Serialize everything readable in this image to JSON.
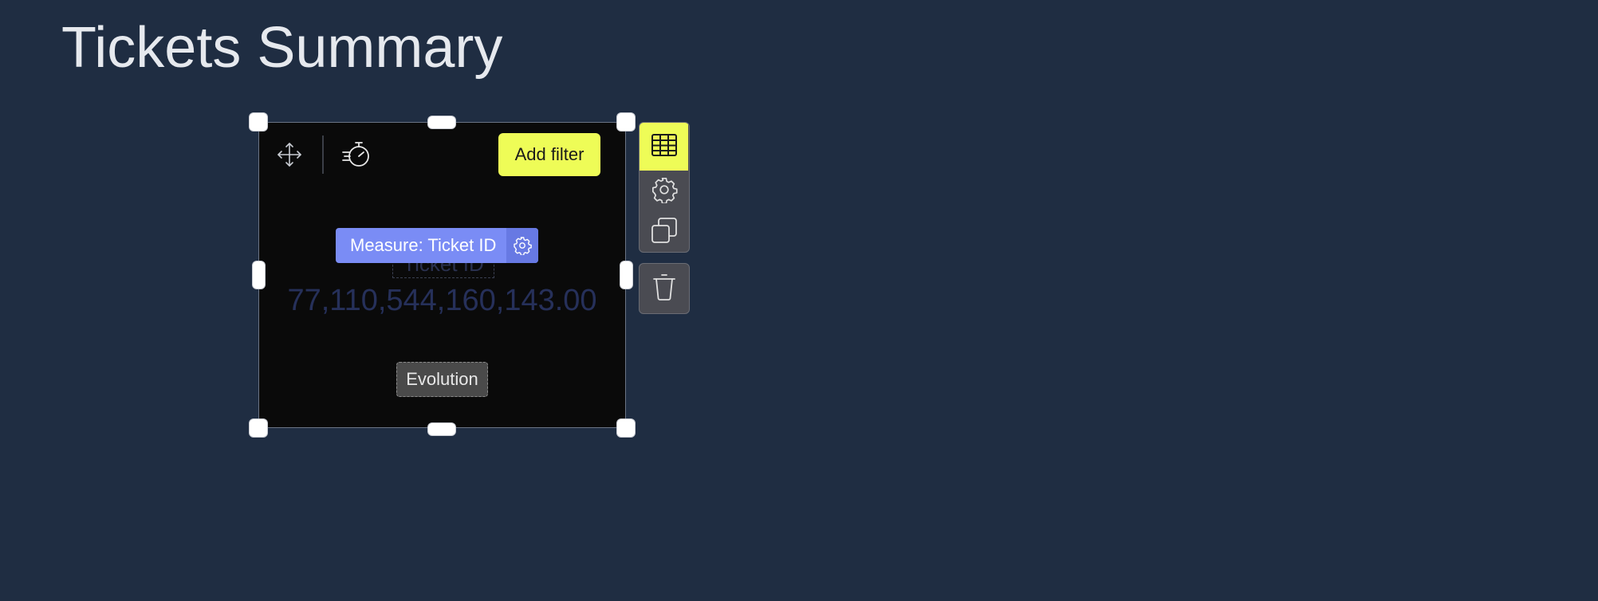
{
  "page": {
    "title": "Tickets Summary"
  },
  "widget": {
    "add_filter_label": "Add filter",
    "ghost_label": "Ticket ID",
    "measure_label": "Measure: Ticket ID",
    "kpi_value": "77,110,544,160,143.00",
    "evolution_label": "Evolution",
    "icons": {
      "move": "move-arrows-icon",
      "timer": "stopwatch-icon",
      "measure_settings": "gear-icon"
    }
  },
  "side_panel": {
    "actions": [
      {
        "name": "table-icon",
        "active": true
      },
      {
        "name": "gear-icon",
        "active": false
      },
      {
        "name": "duplicate-icon",
        "active": false
      }
    ],
    "delete": {
      "name": "trash-icon"
    }
  },
  "colors": {
    "background": "#1f2d42",
    "accent": "#eefc57",
    "measure": "#7a8cf5",
    "widget_bg": "#0a0a0a"
  }
}
